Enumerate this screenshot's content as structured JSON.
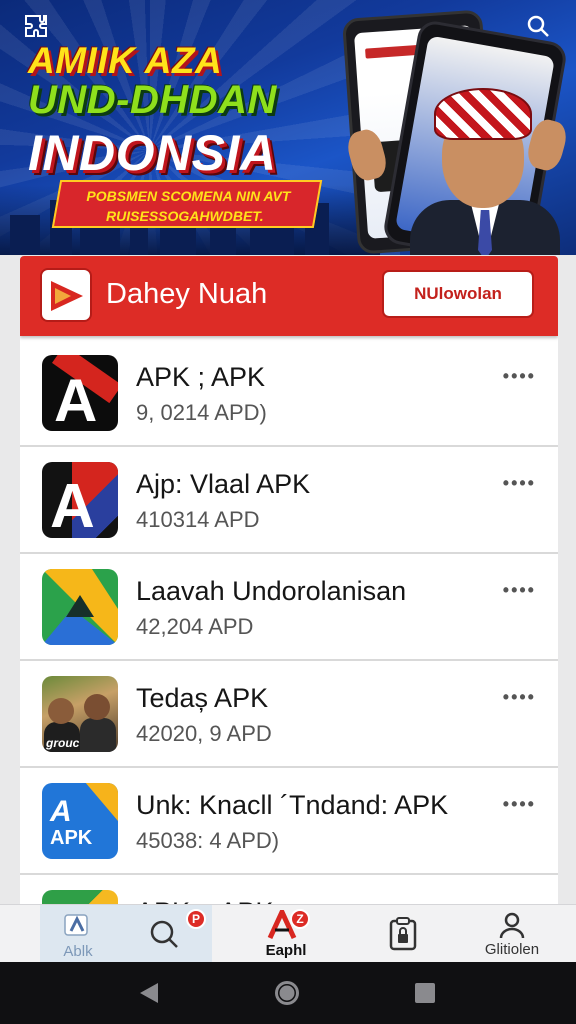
{
  "banner": {
    "line1": "AMIIK AZA",
    "line2": "UND-DHDAN",
    "line3": "INDONSIA",
    "ribbon_line1": "POBSMEN SCOMENA NIN AVT",
    "ribbon_line2": "RUISESSOGAHWDBET.",
    "top_left_icon": "puzzle-icon",
    "top_right_icon": "search-icon"
  },
  "header": {
    "title": "Dahey Nuah",
    "button_label": "NUlowolan"
  },
  "apps": [
    {
      "name": "APK ; APK",
      "size": "9, 0214 APD)",
      "icon": "apk-a-red-band"
    },
    {
      "name": "Ajp: Vlaal  APK",
      "size": "410314 APD",
      "icon": "apk-a-stripes"
    },
    {
      "name": "Laavah Undorolanisan",
      "size": "42,204 APD",
      "icon": "google-drive"
    },
    {
      "name": "Tedaș APK",
      "size": "42020, 9 APD",
      "icon": "photo-people"
    },
    {
      "name": "Unk: Knacll ´Tndand: APK",
      "size": "45038: 4 APD)",
      "icon": "apk-blue-orange"
    },
    {
      "name": "APK + APK",
      "size": "",
      "icon": "apk-colorful"
    }
  ],
  "more_glyph": "••••",
  "nav": {
    "items": [
      {
        "label": "Ablk",
        "icon": "home-icon"
      },
      {
        "label": "",
        "icon": "search-icon",
        "badge": "P"
      },
      {
        "label": "Eaphl",
        "icon": "apk-logo-icon",
        "badge": "Z"
      },
      {
        "label": "",
        "icon": "clipboard-lock-icon"
      },
      {
        "label": "Glitiolen",
        "icon": "profile-icon"
      }
    ]
  },
  "colors": {
    "accent": "#dd2c26",
    "banner_blue": "#123a9c",
    "headline_yellow": "#ffe31a",
    "headline_green": "#8fe01c"
  }
}
